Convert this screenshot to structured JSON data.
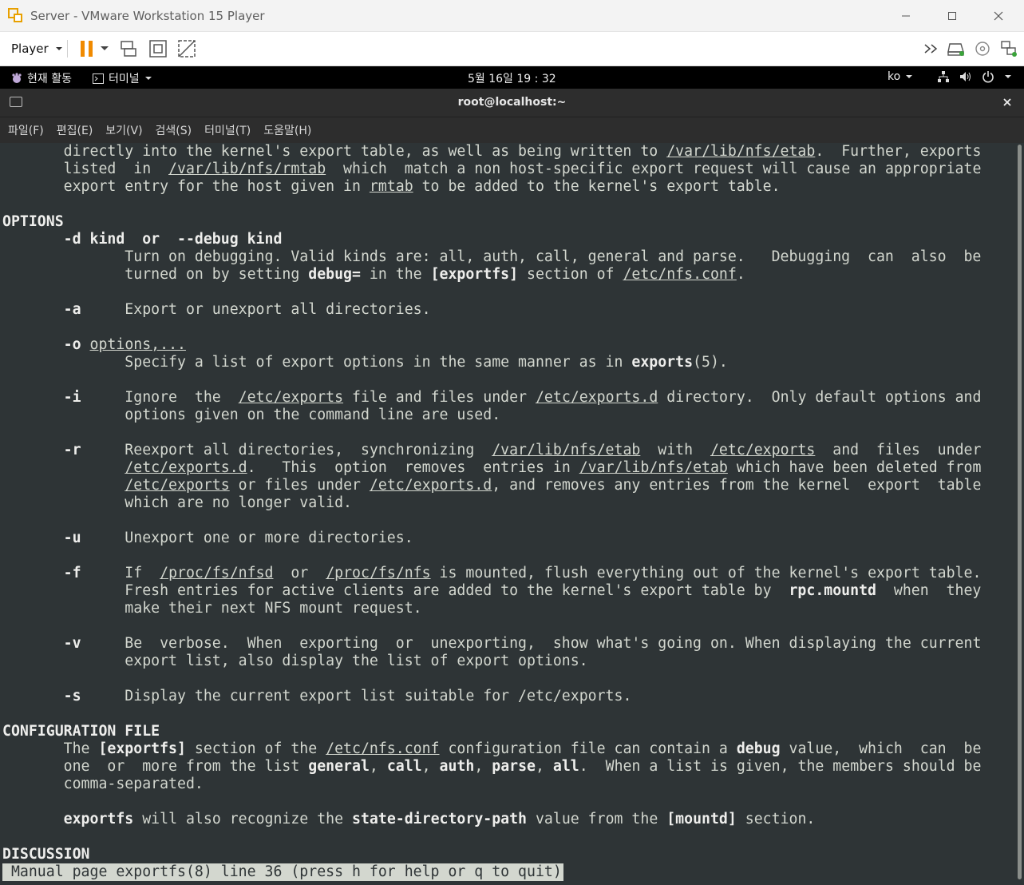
{
  "window": {
    "title": "Server - VMware Workstation 15 Player"
  },
  "toolbar": {
    "player_label": "Player"
  },
  "gnome": {
    "activities": "현재 활동",
    "app_menu": "터미널",
    "clock": "5월 16일  19 : 32",
    "input_method": "ko"
  },
  "terminal": {
    "title": "root@localhost:~",
    "menu": [
      "파일(F)",
      "편집(E)",
      "보기(V)",
      "검색(S)",
      "터미널(T)",
      "도움말(H)"
    ],
    "lines": [
      [
        [
          "       directly into the kernel's export table, as well as being written to ",
          ""
        ],
        [
          "/var/lib/nfs/etab",
          "u"
        ],
        [
          ".  Further, exports",
          ""
        ]
      ],
      [
        [
          "       listed  in  ",
          ""
        ],
        [
          "/var/lib/nfs/rmtab",
          "u"
        ],
        [
          "  which  match a non host-specific export request will cause an appropriate",
          ""
        ]
      ],
      [
        [
          "       export entry for the host given in ",
          ""
        ],
        [
          "rmtab",
          "u"
        ],
        [
          " to be added to the kernel's export table.",
          ""
        ]
      ],
      [
        [
          "",
          ""
        ]
      ],
      [
        [
          "OPTIONS",
          "b"
        ]
      ],
      [
        [
          "       ",
          ""
        ],
        [
          "-d kind  or  --debug kind",
          "b"
        ]
      ],
      [
        [
          "              Turn on debugging. Valid kinds are: all, auth, call, general and parse.   Debugging  can  also  be",
          ""
        ]
      ],
      [
        [
          "              turned on by setting ",
          ""
        ],
        [
          "debug=",
          "b"
        ],
        [
          " in the ",
          ""
        ],
        [
          "[exportfs]",
          "b"
        ],
        [
          " section of ",
          ""
        ],
        [
          "/etc/nfs.conf",
          "u"
        ],
        [
          ".",
          ""
        ]
      ],
      [
        [
          "",
          ""
        ]
      ],
      [
        [
          "       ",
          ""
        ],
        [
          "-a",
          "b"
        ],
        [
          "     Export or unexport all directories.",
          ""
        ]
      ],
      [
        [
          "",
          ""
        ]
      ],
      [
        [
          "       ",
          ""
        ],
        [
          "-o",
          "b"
        ],
        [
          " ",
          ""
        ],
        [
          "options,...",
          "u"
        ]
      ],
      [
        [
          "              Specify a list of export options in the same manner as in ",
          ""
        ],
        [
          "exports",
          "b"
        ],
        [
          "(5).",
          ""
        ]
      ],
      [
        [
          "",
          ""
        ]
      ],
      [
        [
          "       ",
          ""
        ],
        [
          "-i",
          "b"
        ],
        [
          "     Ignore  the  ",
          ""
        ],
        [
          "/etc/exports",
          "u"
        ],
        [
          " file and files under ",
          ""
        ],
        [
          "/etc/exports.d",
          "u"
        ],
        [
          " directory.  Only default options and",
          ""
        ]
      ],
      [
        [
          "              options given on the command line are used.",
          ""
        ]
      ],
      [
        [
          "",
          ""
        ]
      ],
      [
        [
          "       ",
          ""
        ],
        [
          "-r",
          "b"
        ],
        [
          "     Reexport all directories,  synchronizing  ",
          ""
        ],
        [
          "/var/lib/nfs/etab",
          "u"
        ],
        [
          "  with  ",
          ""
        ],
        [
          "/etc/exports",
          "u"
        ],
        [
          "  and  files  under",
          ""
        ]
      ],
      [
        [
          "              ",
          ""
        ],
        [
          "/etc/exports.d",
          "u"
        ],
        [
          ".   This  option  removes  entries in ",
          ""
        ],
        [
          "/var/lib/nfs/etab",
          "u"
        ],
        [
          " which have been deleted from",
          ""
        ]
      ],
      [
        [
          "              ",
          ""
        ],
        [
          "/etc/exports",
          "u"
        ],
        [
          " or files under ",
          ""
        ],
        [
          "/etc/exports.d",
          "u"
        ],
        [
          ", and removes any entries from the kernel  export  table",
          ""
        ]
      ],
      [
        [
          "              which are no longer valid.",
          ""
        ]
      ],
      [
        [
          "",
          ""
        ]
      ],
      [
        [
          "       ",
          ""
        ],
        [
          "-u",
          "b"
        ],
        [
          "     Unexport one or more directories.",
          ""
        ]
      ],
      [
        [
          "",
          ""
        ]
      ],
      [
        [
          "       ",
          ""
        ],
        [
          "-f",
          "b"
        ],
        [
          "     If  ",
          ""
        ],
        [
          "/proc/fs/nfsd",
          "u"
        ],
        [
          "  or  ",
          ""
        ],
        [
          "/proc/fs/nfs",
          "u"
        ],
        [
          " is mounted, flush everything out of the kernel's export table.",
          ""
        ]
      ],
      [
        [
          "              Fresh entries for active clients are added to the kernel's export table by  ",
          ""
        ],
        [
          "rpc.mountd",
          "b"
        ],
        [
          "  when  they",
          ""
        ]
      ],
      [
        [
          "              make their next NFS mount request.",
          ""
        ]
      ],
      [
        [
          "",
          ""
        ]
      ],
      [
        [
          "       ",
          ""
        ],
        [
          "-v",
          "b"
        ],
        [
          "     Be  verbose.  When  exporting  or  unexporting,  show what's going on. When displaying the current",
          ""
        ]
      ],
      [
        [
          "              export list, also display the list of export options.",
          ""
        ]
      ],
      [
        [
          "",
          ""
        ]
      ],
      [
        [
          "       ",
          ""
        ],
        [
          "-s",
          "b"
        ],
        [
          "     Display the current export list suitable for /etc/exports.",
          ""
        ]
      ],
      [
        [
          "",
          ""
        ]
      ],
      [
        [
          "CONFIGURATION FILE",
          "b"
        ]
      ],
      [
        [
          "       The ",
          ""
        ],
        [
          "[exportfs]",
          "b"
        ],
        [
          " section of the ",
          ""
        ],
        [
          "/etc/nfs.conf",
          "u"
        ],
        [
          " configuration file can contain a ",
          ""
        ],
        [
          "debug",
          "b"
        ],
        [
          " value,  which  can  be",
          ""
        ]
      ],
      [
        [
          "       one  or  more from the list ",
          ""
        ],
        [
          "general",
          "b"
        ],
        [
          ", ",
          ""
        ],
        [
          "call",
          "b"
        ],
        [
          ", ",
          ""
        ],
        [
          "auth",
          "b"
        ],
        [
          ", ",
          ""
        ],
        [
          "parse",
          "b"
        ],
        [
          ", ",
          ""
        ],
        [
          "all",
          "b"
        ],
        [
          ".  When a list is given, the members should be",
          ""
        ]
      ],
      [
        [
          "       comma-separated.",
          ""
        ]
      ],
      [
        [
          "",
          ""
        ]
      ],
      [
        [
          "       ",
          ""
        ],
        [
          "exportfs",
          "b"
        ],
        [
          " will also recognize the ",
          ""
        ],
        [
          "state-directory-path",
          "b"
        ],
        [
          " value from the ",
          ""
        ],
        [
          "[mountd]",
          "b"
        ],
        [
          " section.",
          ""
        ]
      ],
      [
        [
          "",
          ""
        ]
      ],
      [
        [
          "DISCUSSION",
          "b"
        ]
      ]
    ],
    "status": " Manual page exportfs(8) line 36 (press h for help or q to quit)"
  }
}
